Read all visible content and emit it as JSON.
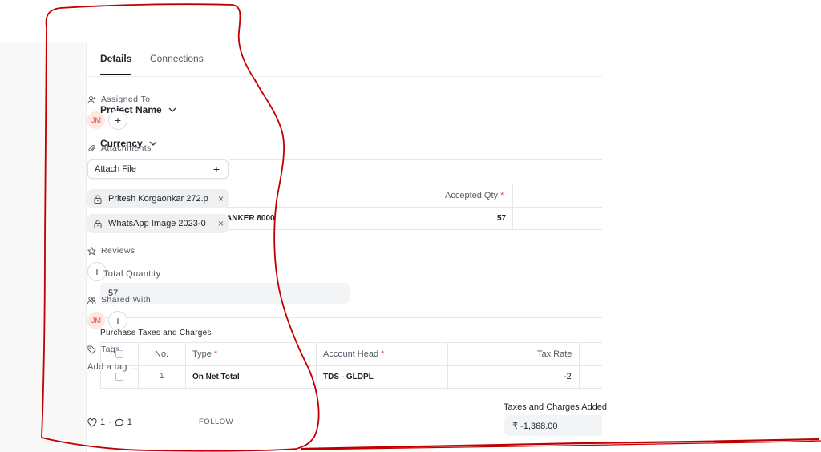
{
  "tabs": [
    {
      "label": "Details"
    },
    {
      "label": "Connections"
    }
  ],
  "sidebar": {
    "assigned_to": {
      "label": "Assigned To",
      "avatar": "JM"
    },
    "attachments": {
      "label": "Attachments",
      "attach_button": "Attach File",
      "files": [
        "Pritesh Korgaonkar 272.p",
        "WhatsApp Image 2023-0"
      ]
    },
    "reviews": {
      "label": "Reviews"
    },
    "shared_with": {
      "label": "Shared With",
      "avatar": "JM"
    },
    "tags": {
      "label": "Tags",
      "add_tag": "Add a tag ..."
    },
    "likes": "1",
    "comments": "1",
    "follow": "FOLLOW"
  },
  "form": {
    "project_name": "Project Name",
    "currency": "Currency",
    "items_table": {
      "header_accepted_qty": "Accepted Qty",
      "row_item": "ANKER 8000",
      "row_accepted_qty": "57"
    },
    "total_quantity": {
      "label": "Total Quantity",
      "value": "57"
    },
    "taxes_section": "Purchase Taxes and Charges",
    "taxes_table": {
      "columns": [
        "No.",
        "Type",
        "Account Head",
        "Tax Rate"
      ],
      "rows": [
        {
          "no": "1",
          "type": "On Net Total",
          "account_head": "TDS - GLDPL",
          "tax_rate": "-2"
        }
      ]
    },
    "taxes_added": {
      "label": "Taxes and Charges Added",
      "value": "₹ -1,368.00"
    }
  },
  "required_mark": "*",
  "colors": {
    "annotation": "#c00000",
    "avatar_bg": "#fde7e3",
    "avatar_text": "#d9534f"
  }
}
